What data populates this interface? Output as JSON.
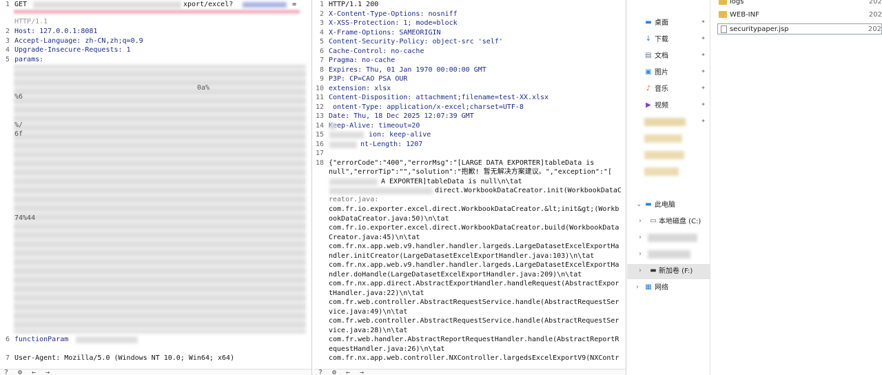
{
  "request": {
    "line_numbers": [
      "1",
      "2",
      "3",
      "4",
      "5",
      "6",
      "7"
    ],
    "method": "GET",
    "url_partial": "xport/excel?",
    "url_tail": "=",
    "protocol": "HTTP/1.1",
    "host_header": "Host: 127.0.0.1:8081",
    "accept_language": "Accept-Language: zh-CN,zh;q=0.9",
    "upgrade_insecure": "Upgrade-Insecure-Requests: 1",
    "params_label": "params:",
    "frag_a": "%6",
    "frag_b": "%/",
    "frag_c": "6f",
    "frag_d": "0a%",
    "frag_e": "74%44",
    "function_param": "functionParam",
    "user_agent": "User-Agent: Mozilla/5.0 (Windows NT 10.0; Win64; x64)"
  },
  "response": {
    "line_numbers": [
      "1",
      "2",
      "3",
      "4",
      "5",
      "6",
      "7",
      "8",
      "9",
      "10",
      "11",
      "12",
      "13",
      "14",
      "15",
      "16",
      "17",
      "18"
    ],
    "status": "HTTP/1.1 200",
    "headers": [
      "X-Content-Type-Options: nosniff",
      "X-XSS-Protection: 1; mode=block",
      "X-Frame-Options: SAMEORIGIN",
      "Content-Security-Policy: object-src 'self'",
      "Cache-Control: no-cache",
      "Pragma: no-cache",
      "Expires: Thu, 01 Jan 1970 00:00:00 GMT",
      "P3P: CP=CAO PSA OUR",
      "extension: xlsx",
      "Content-Disposition: attachment;filename=test-XX.xlsx",
      "ontent-Type: application/x-excel;charset=UTF-8",
      "Date: Thu, 18 Dec 2025 12:07:39 GMT",
      "Keep-Alive: timeout=20",
      "ion: keep-alive",
      "nt-Length: 1207"
    ],
    "body_l1": "{\"errorCode\":\"400\",\"errorMsg\":\"[LARGE DATA EXPORTER]tableData is",
    "body_l2": "null\",\"errorTip\":\"\",\"solution\":\"抱歉! 暂无解决方案建议。\",\"exception\":\"[",
    "body_l3": "A EXPORTER]tableData is null\\n\\tat",
    "body_l4": "direct.WorkbookDataCreator.init(WorkbookDataC",
    "body_l5": "reator.java:",
    "stack": [
      "com.fr.io.exporter.excel.direct.WorkbookDataCreator.&lt;init&gt;(Workb",
      "ookDataCreator.java:50)\\n\\tat",
      "com.fr.io.exporter.excel.direct.WorkbookDataCreator.build(WorkbookData",
      "Creator.java:45)\\n\\tat",
      "com.fr.nx.app.web.v9.handler.handler.largeds.LargeDatasetExcelExportHa",
      "ndler.initCreator(LargeDatasetExcelExportHandler.java:103)\\n\\tat",
      "com.fr.nx.app.web.v9.handler.handler.largeds.LargeDatasetExcelExportHa",
      "ndler.doHandle(LargeDatasetExcelExportHandler.java:209)\\n\\tat",
      "com.fr.nx.app.direct.AbstractExportHandler.handleRequest(AbstractExpor",
      "tHandler.java:22)\\n\\tat",
      "com.fr.web.controller.AbstractRequestService.handle(AbstractRequestSer",
      "vice.java:49)\\n\\tat",
      "com.fr.web.controller.AbstractRequestService.handle(AbstractRequestSer",
      "vice.java:28)\\n\\tat",
      "com.fr.web.handler.AbstractReportRequestHandler.handle(AbstractReportR",
      "equestHandler.java:26)\\n\\tat",
      "com.fr.nx.app.web.controller.NXController.largedsExcelExportV9(NXContr"
    ]
  },
  "explorer_nav": {
    "items": [
      {
        "label": "桌面",
        "icon": "desktop-icon"
      },
      {
        "label": "下载",
        "icon": "download-icon"
      },
      {
        "label": "文档",
        "icon": "document-icon"
      },
      {
        "label": "图片",
        "icon": "picture-icon"
      },
      {
        "label": "音乐",
        "icon": "music-icon"
      },
      {
        "label": "视频",
        "icon": "video-icon"
      }
    ],
    "this_pc": "此电脑",
    "local_disk": "本地磁盘 (C:)",
    "new_volume": "新加卷 (F:)",
    "network": "网络"
  },
  "explorer_files": [
    {
      "name": "logs",
      "date": "202",
      "type": "folder"
    },
    {
      "name": "WEB-INF",
      "date": "202",
      "type": "folder"
    },
    {
      "name": "securitypaper.jsp",
      "date": "202",
      "type": "file"
    }
  ],
  "colors": {
    "folder": "#e8b94a",
    "key_blue": "#1e2a8c",
    "selection": "#e5e5e5"
  }
}
